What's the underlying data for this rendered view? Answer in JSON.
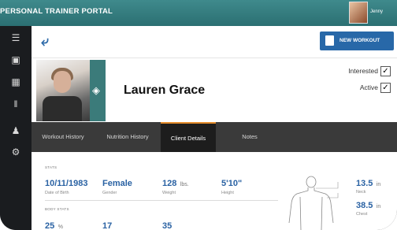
{
  "app": {
    "title": "PERSONAL TRAINER PORTAL",
    "user_name": "Jenny"
  },
  "toolbar": {
    "new_workout_label": "NEW WORKOUT"
  },
  "client": {
    "name": "Lauren Grace",
    "interested_label": "Interested",
    "interested_checked": "✓",
    "active_label": "Active",
    "active_checked": "✓"
  },
  "tabs": [
    {
      "label": "Workout History"
    },
    {
      "label": "Nutrition History"
    },
    {
      "label": "Client Details"
    },
    {
      "label": "Notes"
    }
  ],
  "active_tab": "Client Details",
  "stats": {
    "section_label": "STATS",
    "items": [
      {
        "value": "10/11/1983",
        "unit": "",
        "label": "Date of Birth"
      },
      {
        "value": "Female",
        "unit": "",
        "label": "Gender"
      },
      {
        "value": "128",
        "unit": "lbs.",
        "label": "Weight"
      },
      {
        "value": "5'10\"",
        "unit": "",
        "label": "Height"
      }
    ]
  },
  "body_stats": {
    "section_label": "BODY STATS",
    "items": [
      {
        "value": "25",
        "unit": "%"
      },
      {
        "value": "17",
        "unit": ""
      },
      {
        "value": "35",
        "unit": ""
      }
    ]
  },
  "measurements": [
    {
      "value": "13.5",
      "unit": "in",
      "label": "Neck"
    },
    {
      "value": "38.5",
      "unit": "in",
      "label": "Chest"
    }
  ],
  "colors": {
    "teal": "#3b7b7a",
    "blue": "#2868a8",
    "tab_accent": "#e38b2a"
  }
}
